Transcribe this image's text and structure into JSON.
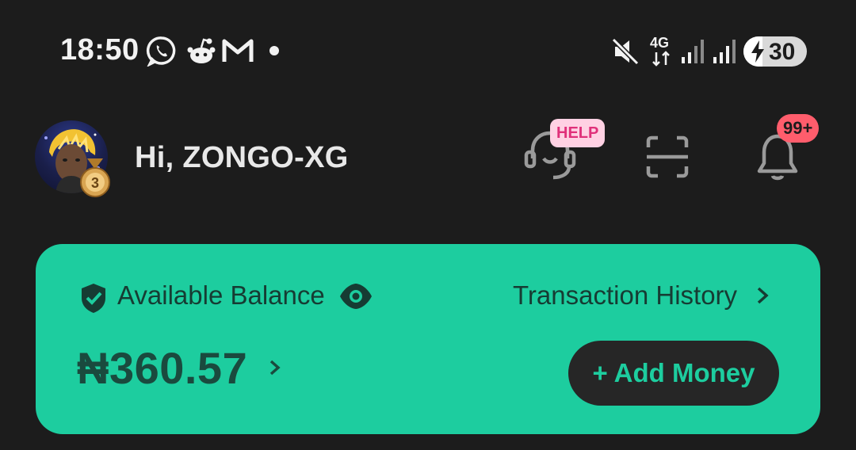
{
  "status_bar": {
    "time": "18:50",
    "icons": [
      "whatsapp-icon",
      "reddit-icon",
      "gmail-icon",
      "notification-dot",
      "mute-icon",
      "4g-icon",
      "signal-icon",
      "signal-icon",
      "battery-charging-icon"
    ],
    "network": "4G",
    "battery_level": "30",
    "battery_fraction": 0.3
  },
  "header": {
    "greeting": "Hi, ZONGO-XG",
    "medal_level": "3",
    "help_badge": "HELP",
    "notification_count": "99+"
  },
  "balance_card": {
    "label": "Available Balance",
    "history_label": "Transaction History",
    "amount": "₦360.57",
    "add_money_label": "+ Add Money"
  },
  "colors": {
    "background": "#1c1c1c",
    "accent": "#1dcd9f",
    "help_badge_bg": "#ffd1e3",
    "help_badge_text": "#e0307a",
    "notification_badge": "#ff5d6c",
    "button_dark": "#262626"
  }
}
